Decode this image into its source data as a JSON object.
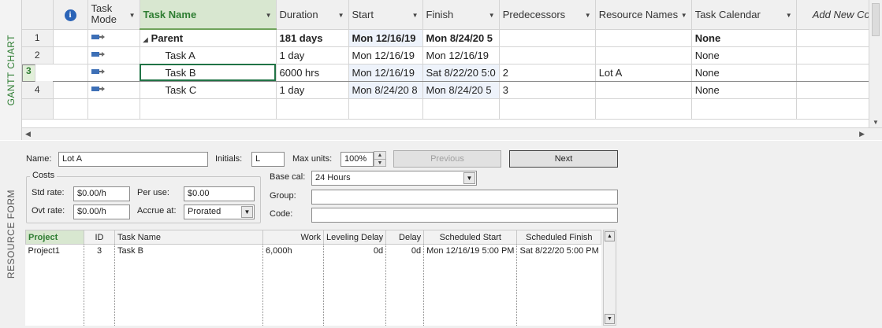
{
  "gantt": {
    "side_label": "GANTT CHART",
    "columns": {
      "info": "i",
      "task_mode": "Task Mode",
      "task_name": "Task Name",
      "duration": "Duration",
      "start": "Start",
      "finish": "Finish",
      "predecessors": "Predecessors",
      "resource_names": "Resource Names",
      "task_calendar": "Task Calendar",
      "add_new": "Add New Co"
    },
    "rows": [
      {
        "id": "1",
        "name": "Parent",
        "duration": "181 days",
        "start": "Mon 12/16/19",
        "finish": "Mon 8/24/20 5",
        "predecessors": "",
        "resources": "",
        "calendar": "None"
      },
      {
        "id": "2",
        "name": "Task A",
        "duration": "1 day",
        "start": "Mon 12/16/19",
        "finish": "Mon 12/16/19",
        "predecessors": "",
        "resources": "",
        "calendar": "None"
      },
      {
        "id": "3",
        "name": "Task B",
        "duration": "6000 hrs",
        "start": "Mon 12/16/19",
        "finish": "Sat 8/22/20 5:0",
        "predecessors": "2",
        "resources": "Lot A",
        "calendar": "None"
      },
      {
        "id": "4",
        "name": "Task C",
        "duration": "1 day",
        "start": "Mon 8/24/20 8",
        "finish": "Mon 8/24/20 5",
        "predecessors": "3",
        "resources": "",
        "calendar": "None"
      }
    ]
  },
  "resource_form": {
    "side_label": "RESOURCE FORM",
    "name_label": "Name:",
    "name_value": "Lot A",
    "initials_label": "Initials:",
    "initials_value": "L",
    "max_units_label": "Max units:",
    "max_units_value": "100%",
    "previous_label": "Previous",
    "next_label": "Next",
    "costs_title": "Costs",
    "std_rate_label": "Std rate:",
    "std_rate_value": "$0.00/h",
    "per_use_label": "Per use:",
    "per_use_value": "$0.00",
    "ovt_rate_label": "Ovt rate:",
    "ovt_rate_value": "$0.00/h",
    "accrue_label": "Accrue at:",
    "accrue_value": "Prorated",
    "base_cal_label": "Base cal:",
    "base_cal_value": "24 Hours",
    "group_label": "Group:",
    "group_value": "",
    "code_label": "Code:",
    "code_value": "",
    "table": {
      "headers": {
        "project": "Project",
        "id": "ID",
        "task_name": "Task Name",
        "work": "Work",
        "leveling_delay": "Leveling Delay",
        "delay": "Delay",
        "scheduled_start": "Scheduled Start",
        "scheduled_finish": "Scheduled Finish"
      },
      "row": {
        "project": "Project1",
        "id": "3",
        "task_name": "Task B",
        "work": "6,000h",
        "leveling_delay": "0d",
        "delay": "0d",
        "scheduled_start": "Mon 12/16/19 5:00 PM",
        "scheduled_finish": "Sat 8/22/20 5:00 PM"
      }
    }
  }
}
